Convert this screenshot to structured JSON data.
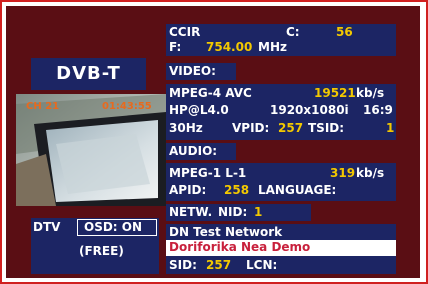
{
  "standard_label": "DVB-T",
  "thumbnail": {
    "overlay_left": "CH 21",
    "overlay_right": "01:43:55"
  },
  "status": {
    "dtv": "DTV",
    "osd": "OSD: ON",
    "free": "(FREE)"
  },
  "tuner": {
    "system": "CCIR",
    "c_label": "C:",
    "c_value": "56",
    "f_label": "F:",
    "f_value": "754.00",
    "f_unit": "MHz"
  },
  "video": {
    "header": "VIDEO:",
    "codec": "MPEG-4 AVC",
    "bitrate": "19521",
    "bitrate_unit": "kb/s",
    "profile": "HP@L4.0",
    "resolution": "1920x1080i",
    "aspect": "16:9",
    "frame_rate": "30Hz",
    "vpid_label": "VPID:",
    "vpid_value": "257",
    "tsid_label": "TSID:",
    "tsid_value": "1"
  },
  "audio": {
    "header": "AUDIO:",
    "codec": "MPEG-1 L-1",
    "bitrate": "319",
    "bitrate_unit": "kb/s",
    "apid_label": "APID:",
    "apid_value": "258",
    "language_label": "LANGUAGE:"
  },
  "network": {
    "header_label": "NETW.",
    "nid_label": "NID:",
    "nid_value": "1",
    "name": "DN Test Network",
    "service": "Doriforika Nea Demo",
    "sid_label": "SID:",
    "sid_value": "257",
    "lcn_label": "LCN:"
  },
  "colors": {
    "frame": "#d02020",
    "background": "#5a0e14",
    "panel": "#1c2564",
    "value": "#f2c800",
    "highlight": "#ffffff",
    "service_text": "#c8203c"
  }
}
